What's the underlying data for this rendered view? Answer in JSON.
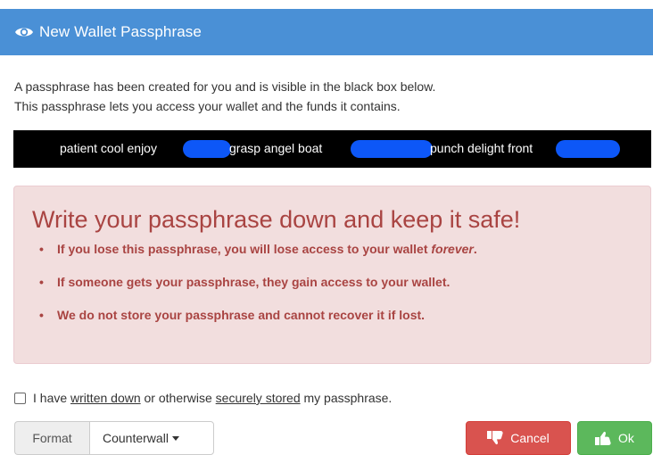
{
  "dialog": {
    "title": "New Wallet Passphrase",
    "title_icon": "eye-icon",
    "header_color": "#4a90d6"
  },
  "intro": {
    "line1": "A passphrase has been created for you and is visible in the black box below.",
    "line2": "This passphrase lets you access your wallet and the funds it contains."
  },
  "passphrase": {
    "segment1": "patient cool enjoy",
    "segment2": "grasp angel boat",
    "segment3": "punch delight front",
    "redaction_color": "#0d57f7"
  },
  "warning": {
    "heading": "Write your passphrase down and keep it safe!",
    "item1_text": "If you lose this passphrase, you will lose access to your wallet ",
    "item1_emphasis": "forever",
    "item1_end": ".",
    "item2": "If someone gets your passphrase, they gain access to your wallet.",
    "item3": "We do not store your passphrase and cannot recover it if lost."
  },
  "confirm": {
    "checked": false,
    "prefix": "I have ",
    "link1": "written down",
    "middle": " or otherwise ",
    "link2": "securely stored",
    "suffix": " my passphrase."
  },
  "format": {
    "label": "Format",
    "selected": "Counterwall"
  },
  "buttons": {
    "cancel": "Cancel",
    "cancel_icon": "thumbs-down-icon",
    "cancel_color": "#d9534f",
    "ok": "Ok",
    "ok_icon": "thumbs-up-icon",
    "ok_color": "#5cb85c"
  }
}
